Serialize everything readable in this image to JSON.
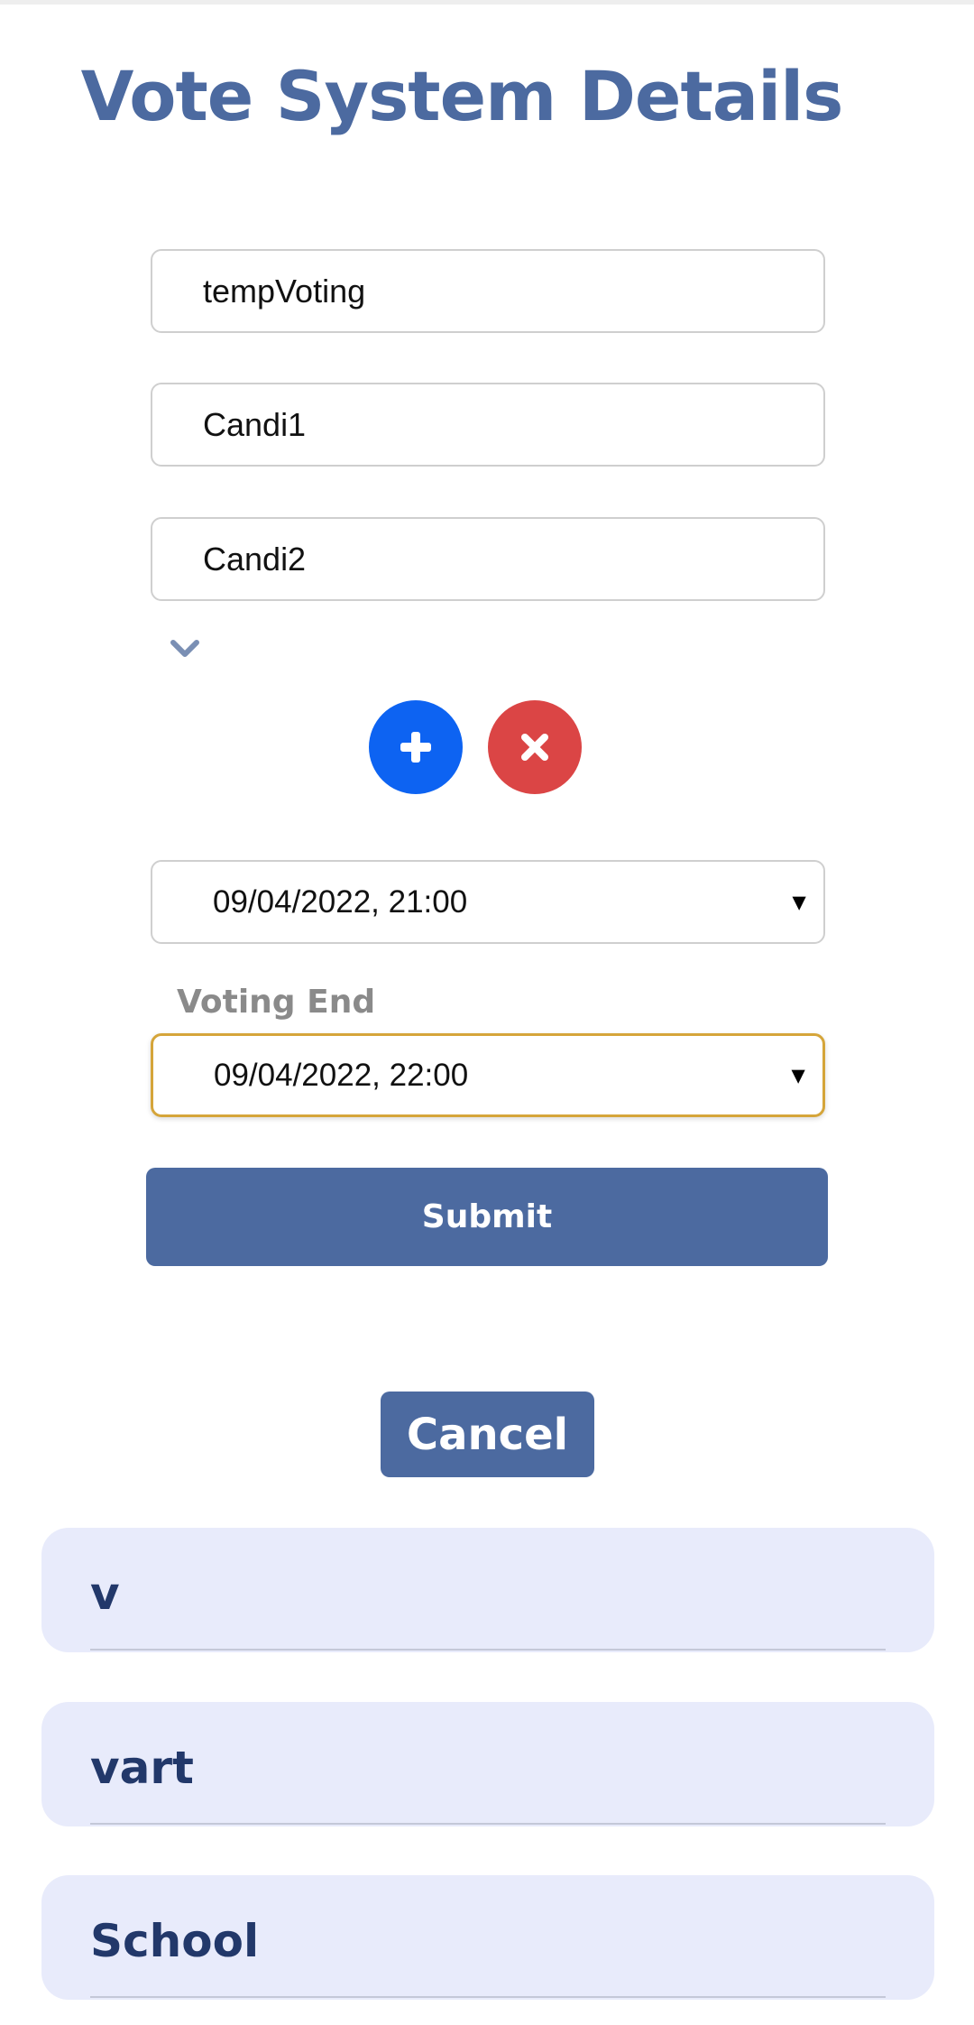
{
  "page": {
    "title": "Vote System Details"
  },
  "form": {
    "vote_name": "tempVoting",
    "candidates": [
      "Candi1",
      "Candi2"
    ],
    "voting_start": "09/04/2022, 21:00",
    "voting_end_label": "Voting End",
    "voting_end": "09/04/2022, 22:00",
    "submit_label": "Submit",
    "cancel_label": "Cancel"
  },
  "icons": {
    "expand": "chevron-down-icon",
    "add": "plus-icon",
    "remove": "close-icon"
  },
  "colors": {
    "primary": "#4c6aa0",
    "add": "#0d63f2",
    "remove": "#db4545",
    "focus": "#d5a53a",
    "card_bg": "#e8ebfb",
    "card_text": "#22386a"
  },
  "vote_list": [
    {
      "name": "v"
    },
    {
      "name": "vart"
    },
    {
      "name": "School"
    }
  ]
}
